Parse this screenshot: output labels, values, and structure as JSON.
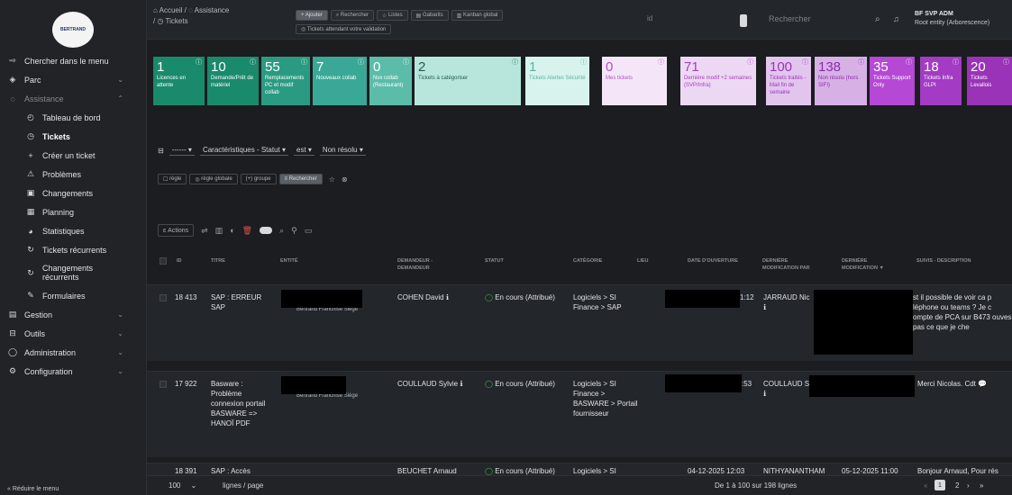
{
  "logo_text": "BERTRAND",
  "sidebar": {
    "items": [
      {
        "label": "Chercher dans le menu",
        "icon": "compass-icon"
      },
      {
        "label": "Parc",
        "icon": "box-icon"
      },
      {
        "label": "Assistance",
        "icon": "headset-icon"
      },
      {
        "label": "Tableau de bord",
        "icon": "dashboard-icon"
      },
      {
        "label": "Tickets",
        "icon": "ticket-icon"
      },
      {
        "label": "Créer un ticket",
        "icon": "plus-icon"
      },
      {
        "label": "Problèmes",
        "icon": "warning-icon"
      },
      {
        "label": "Changements",
        "icon": "clipboard-icon"
      },
      {
        "label": "Planning",
        "icon": "calendar-icon"
      },
      {
        "label": "Statistiques",
        "icon": "chart-icon"
      },
      {
        "label": "Tickets récurrents",
        "icon": "recurring-icon"
      },
      {
        "label": "Changements récurrents",
        "icon": "recurring-change-icon"
      },
      {
        "label": "Formulaires",
        "icon": "form-icon"
      },
      {
        "label": "Gestion",
        "icon": "wallet-icon"
      },
      {
        "label": "Outils",
        "icon": "briefcase-icon"
      },
      {
        "label": "Administration",
        "icon": "shield-icon"
      },
      {
        "label": "Configuration",
        "icon": "gear-icon"
      }
    ],
    "reduce": "Réduire le menu"
  },
  "header": {
    "crumb_home": "Accueil",
    "crumb_sep": "/",
    "crumb_assist": "Assistance",
    "crumb_tickets": "Tickets",
    "btn_add": "+ Ajouter",
    "btn_search": "Rechercher",
    "btn_lists": "Listes",
    "btn_templates": "Gabarits",
    "btn_kanban": "Kanban global",
    "btn_wait": "Tickets attendant votre validation",
    "id_placeholder": "id",
    "search_placeholder": "Rechercher",
    "user_name": "BF SVP ADM",
    "user_entity": "Root entity (Arborescence)"
  },
  "tiles": [
    {
      "num": "1",
      "label": "Licences en attente",
      "bg": "#1a8a6c",
      "fg": "#ffffff"
    },
    {
      "num": "10",
      "label": "Demande/Prêt de matériel",
      "bg": "#1a8a6c",
      "fg": "#ffffff"
    },
    {
      "num": "55",
      "label": "Remplacements PC et modif collab",
      "bg": "#2a9b82",
      "fg": "#ffffff"
    },
    {
      "num": "7",
      "label": "Nouveaux collab",
      "bg": "#3aa896",
      "fg": "#ffffff"
    },
    {
      "num": "0",
      "label": "Nvx collab (Restaurant)",
      "bg": "#5cbcaa",
      "fg": "#ffffff"
    },
    {
      "num": "2",
      "label": "Tickets à catégoriser",
      "bg": "#b8e6dc",
      "fg": "#235c52"
    },
    {
      "num": "1",
      "label": "Tickets Alertes Sécurité",
      "bg": "#d8f3ee",
      "fg": "#5ab3a3"
    },
    {
      "num": "0",
      "label": "Mes tickets",
      "bg": "#f4e6f8",
      "fg": "#b34fc9"
    },
    {
      "num": "71",
      "label": "Dernière modif +2 semaines (SVP/Infra)",
      "bg": "#edd8f3",
      "fg": "#a53fbf"
    },
    {
      "num": "100",
      "label": "Tickets traités - Mail fin de semaine",
      "bg": "#e2c5ed",
      "fg": "#9a33b8"
    },
    {
      "num": "138",
      "label": "Non résolu (hors SIFI)",
      "bg": "#d7b1e6",
      "fg": "#8d2aac"
    },
    {
      "num": "35",
      "label": "Tickets Support Only",
      "bg": "#b548d4",
      "fg": "#ffffff"
    },
    {
      "num": "18",
      "label": "Tickets Infra GLPI",
      "bg": "#a33bc4",
      "fg": "#ffffff"
    },
    {
      "num": "20",
      "label": "Tickets Levallois",
      "bg": "#9a33b8",
      "fg": "#ffffff"
    }
  ],
  "filter": {
    "dash": "------",
    "field": "Caractéristiques - Statut",
    "op": "est",
    "value": "Non résolu"
  },
  "rules": {
    "rule": "règle",
    "global_rule": "règle globale",
    "group": "(+) groupe",
    "search": "Rechercher"
  },
  "actions_label": "Actions",
  "columns": {
    "id": "ID",
    "title": "TITRE",
    "entity": "ENTITÉ",
    "requester_1": "DEMANDEUR -",
    "requester_2": "DEMANDEUR",
    "status": "STATUT",
    "category": "CATÉGORIE",
    "location": "LIEU",
    "open_date": "DATE D'OUVERTURE",
    "last_mod_by_1": "DERNIÈRE",
    "last_mod_by_2": "MODIFICATION PAR",
    "last_mod_1": "DERNIÈRE",
    "last_mod_2": "MODIFICATION ▼",
    "followup": "SUIVIS - DESCRIPTION"
  },
  "rows": [
    {
      "id": "18 413",
      "title": "SAP : ERREUR SAP",
      "entity": "Bertrand Franchise Siège",
      "requester": "COHEN David",
      "status": "En cours (Attribué)",
      "category": "Logiciels > SI Finance > SAP",
      "open_date_tail": "1:12",
      "last_mod_by": "JARRAUD Nic",
      "followup": "st il possible de voir ca p léphone ou teams ? Je c ompte de PCA sur B473 ouves pas ce que je che"
    },
    {
      "id": "17 922",
      "title": "Basware : Problème connexion portail BASWARE => HANOÏ PDF",
      "entity": "Bertrand Franchise Siège",
      "requester": "COULLAUD Sylvie",
      "status": "En cours (Attribué)",
      "category": "Logiciels > SI Finance > BASWARE > Portail fournisseur",
      "open_date_tail": ":53",
      "last_mod_by": "COULLAUD S",
      "followup": "Merci Nicolas. Cdt"
    },
    {
      "id": "18 391",
      "title": "SAP : Accès",
      "requester": "BEUCHET Arnaud",
      "status": "En cours (Attribué)",
      "category": "Logiciels > SI",
      "open_date": "04-12-2025 12:03",
      "last_mod_by": "NITHYANANTHAM",
      "last_mod": "05-12-2025 11:00",
      "followup": "Bonjour Arnaud, Pour rés"
    }
  ],
  "pagination": {
    "size": "100",
    "per_page": "lignes / page",
    "range": "De 1 à 100 sur 198 lignes",
    "page_1": "1",
    "page_2": "2"
  }
}
